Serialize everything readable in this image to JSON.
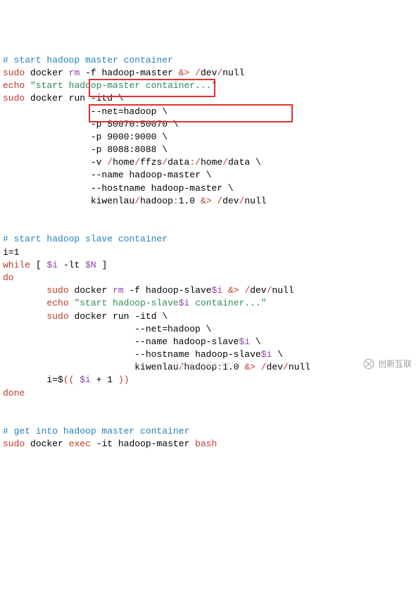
{
  "comments": {
    "c1": "# start hadoop master container",
    "c2": "# start hadoop slave container",
    "c3": "# get into hadoop master container"
  },
  "tokens": {
    "sudo": "sudo",
    "docker": "docker",
    "rm": "rm",
    "dash_f": "-f",
    "hadoop_master": "hadoop-master",
    "redir": "&>",
    "slash": "/",
    "dev": "dev",
    "null": "null",
    "echo": "echo",
    "str_master": "\"start hadoop-master container...\"",
    "run": "run",
    "itd": "-itd",
    "bslash": "\\",
    "net": "--net=hadoop",
    "p": "-p",
    "port1": "50070:50070",
    "port2": "9000:9000",
    "port3": "8088:8088",
    "v": "-v",
    "vol_home": "home",
    "vol_ffzs": "ffzs",
    "vol_data": "data",
    "vol_data2": "data",
    "colon": ":",
    "name": "--name",
    "hostname": "--hostname",
    "img": "kiwenlau",
    "hadoop": "hadoop",
    "tag": "1.0",
    "i_assign": "i=1",
    "while": "while",
    "lbrack": "[",
    "rbrack": "]",
    "dollar_i": "$i",
    "lt": "-lt",
    "dollar_n": "$N",
    "do": "do",
    "slave_pre": "hadoop-slave",
    "str_slave_a": "\"start hadoop-slave",
    "str_slave_b": " container...\"",
    "i_calc_a": "i=$",
    "i_calc_b": "((",
    "plus": "+",
    "one": "1",
    "i_calc_c": "))",
    "done": "done",
    "exec": "exec",
    "it": "-it",
    "bash": "bash"
  },
  "watermark": {
    "text": "创新互联",
    "url": "blog.csdn.net/t"
  }
}
